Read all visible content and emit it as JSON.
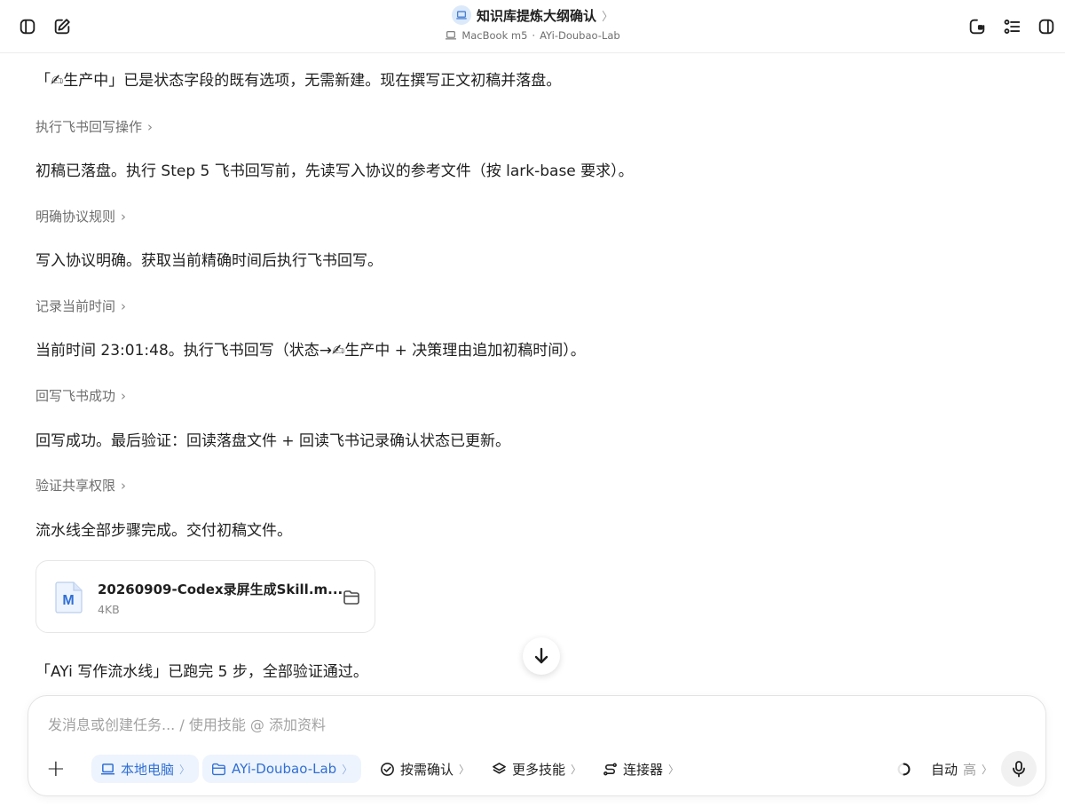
{
  "header": {
    "title": "知识库提炼大纲确认",
    "device": "MacBook m5",
    "separator": "·",
    "workspace": "AYi-Doubao-Lab"
  },
  "messages": {
    "m1": "「✍生产中」已是状态字段的既有选项，无需新建。现在撰写正文初稿并落盘。",
    "s1": "执行飞书回写操作",
    "m2": "初稿已落盘。执行 Step 5 飞书回写前，先读写入协议的参考文件（按 lark-base 要求）。",
    "s2": "明确协议规则",
    "m3": "写入协议明确。获取当前精确时间后执行飞书回写。",
    "s3": "记录当前时间",
    "m4": "当前时间 23:01:48。执行飞书回写（状态→✍生产中 + 决策理由追加初稿时间）。",
    "s4": "回写飞书成功",
    "m5": "回写成功。最后验证：回读落盘文件 + 回读飞书记录确认状态已更新。",
    "s5": "验证共享权限",
    "m6": "流水线全部步骤完成。交付初稿文件。",
    "m7": "「AYi 写作流水线」已跑完 5 步，全部验证通过。"
  },
  "file": {
    "name": "20260909-Codex录屏生成Skill.m...",
    "size": "4KB",
    "icon_letter": "M"
  },
  "composer": {
    "placeholder": "发消息或创建任务... / 使用技能 @ 添加资料",
    "plus": "+",
    "local": "本地电脑",
    "folder": "AYi-Doubao-Lab",
    "confirm": "按需确认",
    "skills": "更多技能",
    "connectors": "连接器",
    "mode": "自动",
    "level": "高"
  },
  "colors": {
    "accent": "#2f6fd6",
    "pill_bg": "#eef4fd"
  }
}
